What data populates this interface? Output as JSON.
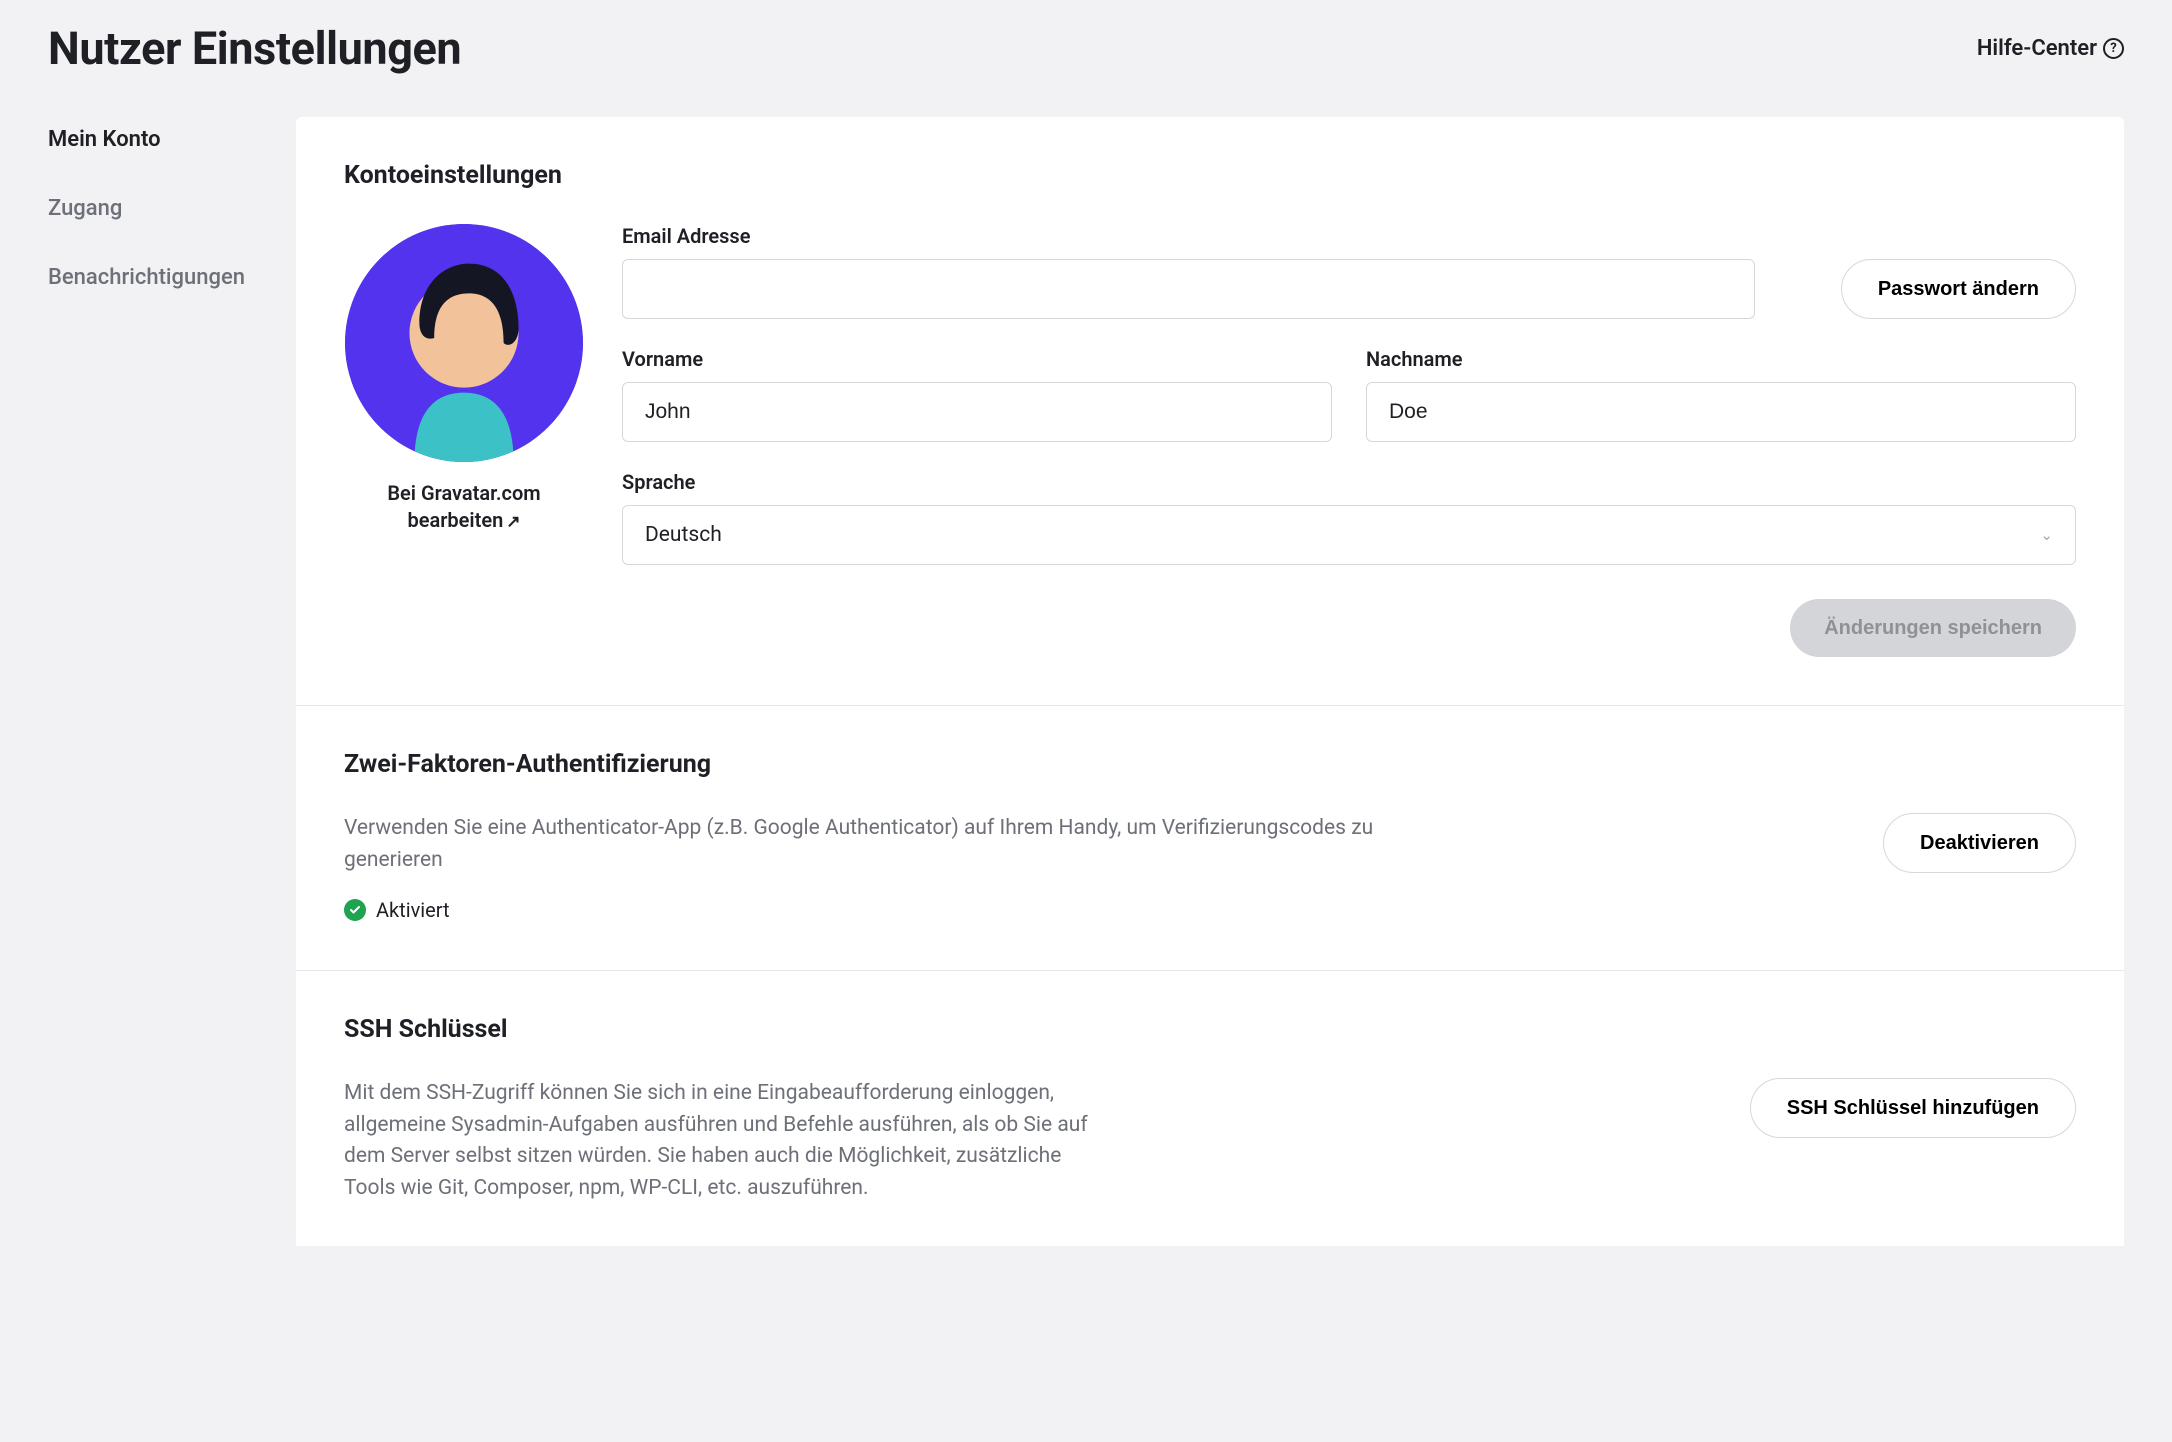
{
  "page_title": "Nutzer Einstellungen",
  "help_center": "Hilfe-Center",
  "sidebar": {
    "items": [
      {
        "label": "Mein Konto",
        "active": true
      },
      {
        "label": "Zugang",
        "active": false
      },
      {
        "label": "Benachrichtigungen",
        "active": false
      }
    ]
  },
  "account": {
    "section_title": "Kontoeinstellungen",
    "avatar_link": "Bei Gravatar.com bearbeiten",
    "email_label": "Email Adresse",
    "email_value": "",
    "password_button": "Passwort ändern",
    "firstname_label": "Vorname",
    "firstname_value": "John",
    "lastname_label": "Nachname",
    "lastname_value": "Doe",
    "language_label": "Sprache",
    "language_value": "Deutsch",
    "save_button": "Änderungen speichern"
  },
  "twofactor": {
    "section_title": "Zwei-Faktoren-Authentifizierung",
    "description": "Verwenden Sie eine Authenticator-App (z.B. Google Authenticator) auf Ihrem Handy, um Verifizierungscodes zu generieren",
    "status_label": "Aktiviert",
    "button": "Deaktivieren"
  },
  "ssh": {
    "section_title": "SSH Schlüssel",
    "description": "Mit dem SSH-Zugriff können Sie sich in eine Eingabeaufforderung einloggen, allgemeine Sysadmin-Aufgaben ausführen und Befehle ausführen, als ob Sie auf dem Server selbst sitzen würden. Sie haben auch die Möglichkeit, zusätzliche Tools wie Git, Composer, npm, WP-CLI, etc. auszuführen.",
    "button": "SSH Schlüssel hinzufügen"
  }
}
